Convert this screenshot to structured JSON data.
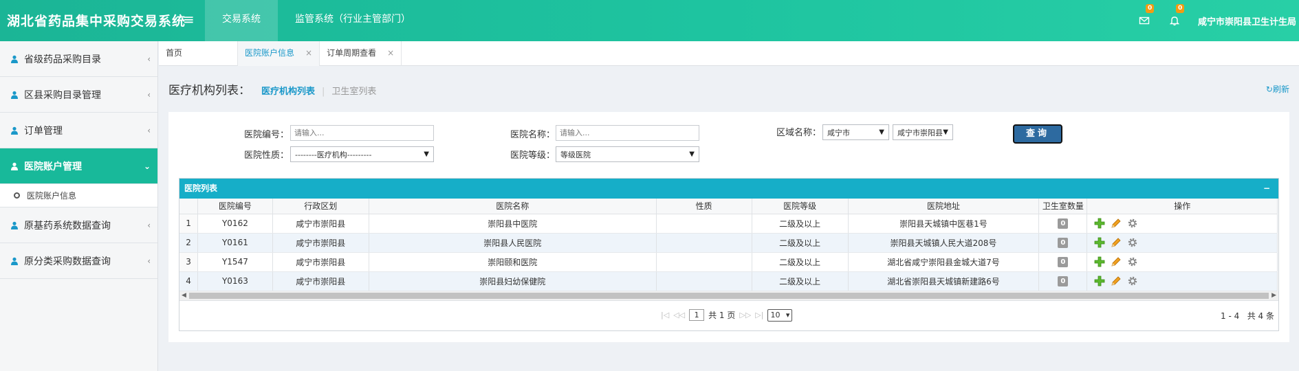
{
  "app": {
    "title": "湖北省药品集中采购交易系统",
    "user": "咸宁市崇阳县卫生计生局"
  },
  "topnav": [
    "交易系统",
    "监管系统（行业主管部门）"
  ],
  "notifications": {
    "mail_count": "0",
    "bell_count": "0"
  },
  "sidebar": {
    "items": [
      {
        "label": "省级药品采购目录"
      },
      {
        "label": "区县采购目录管理"
      },
      {
        "label": "订单管理"
      },
      {
        "label": "医院账户管理"
      },
      {
        "label": "原基药系统数据查询"
      },
      {
        "label": "原分类采购数据查询"
      }
    ],
    "sub_item": "医院账户信息"
  },
  "tabs": [
    "首页",
    "医院账户信息",
    "订单周期查看"
  ],
  "page": {
    "title": "医疗机构列表：",
    "link_active": "医疗机构列表",
    "link_inactive": "卫生室列表",
    "refresh": "刷新"
  },
  "filters": {
    "code_label": "医院编号：",
    "code_placeholder": "请输入...",
    "name_label": "医院名称：",
    "name_placeholder": "请输入...",
    "region_label": "区域名称：",
    "region_city": "咸宁市",
    "region_county": "咸宁市崇阳县",
    "nature_label": "医院性质：",
    "nature_value": "--------医疗机构---------",
    "level_label": "医院等级：",
    "level_value": "等级医院",
    "query_button": "查询"
  },
  "grid": {
    "title": "医院列表",
    "collapse": "−",
    "columns": [
      "医院编号",
      "行政区划",
      "医院名称",
      "性质",
      "医院等级",
      "医院地址",
      "卫生室数量",
      "操作"
    ],
    "rows": [
      {
        "no": "1",
        "code": "Y0162",
        "region": "咸宁市崇阳县",
        "name": "崇阳县中医院",
        "nature": "",
        "level": "二级及以上",
        "address": "崇阳县天城镇中医巷1号",
        "clinics": "0"
      },
      {
        "no": "2",
        "code": "Y0161",
        "region": "咸宁市崇阳县",
        "name": "崇阳县人民医院",
        "nature": "",
        "level": "二级及以上",
        "address": "崇阳县天城镇人民大道208号",
        "clinics": "0"
      },
      {
        "no": "3",
        "code": "Y1547",
        "region": "咸宁市崇阳县",
        "name": "崇阳颐和医院",
        "nature": "",
        "level": "二级及以上",
        "address": "湖北省咸宁崇阳县金城大道7号",
        "clinics": "0"
      },
      {
        "no": "4",
        "code": "Y0163",
        "region": "咸宁市崇阳县",
        "name": "崇阳县妇幼保健院",
        "nature": "",
        "level": "二级及以上",
        "address": "湖北省崇阳县天城镇新建路6号",
        "clinics": "0"
      }
    ]
  },
  "pager": {
    "current": "1",
    "total_text": "共 1 页",
    "page_size": "10",
    "range": "1 - 4",
    "total": "共 4 条"
  },
  "colors": {
    "brand": "#1bb596",
    "accent": "#1a98c9",
    "grid_header": "#16aec8",
    "sidebar_active": "#18b99a"
  }
}
